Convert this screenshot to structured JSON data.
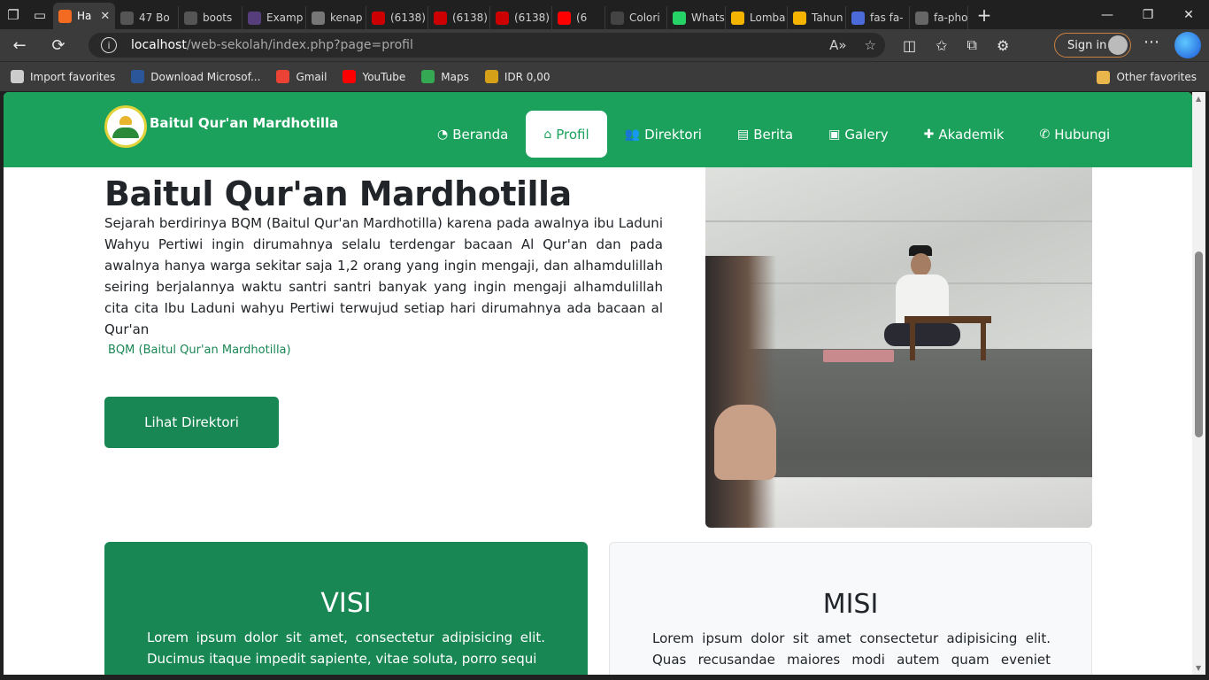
{
  "browser": {
    "tabs": [
      {
        "label": "Ha",
        "favicon": "xampp-icon",
        "color": "#f26b21",
        "active": true
      },
      {
        "label": "47 Bo",
        "favicon": "page-icon",
        "color": "#555555"
      },
      {
        "label": "boots",
        "favicon": "bootstrap-icon",
        "color": "#555555"
      },
      {
        "label": "Examp",
        "favicon": "bootstrap-b-icon",
        "color": "#563d7c"
      },
      {
        "label": "kenap",
        "favicon": "image-icon",
        "color": "#777777"
      },
      {
        "label": "(6138)",
        "favicon": "youtube-icon",
        "color": "#cc0000"
      },
      {
        "label": "(6138)",
        "favicon": "youtube-icon",
        "color": "#cc0000"
      },
      {
        "label": "(6138)",
        "favicon": "youtube-icon",
        "color": "#cc0000"
      },
      {
        "label": "(6",
        "favicon": "youtube-icon",
        "color": "#ff0000"
      },
      {
        "label": "Colori",
        "favicon": "dots-icon",
        "color": "#444444"
      },
      {
        "label": "Whats",
        "favicon": "whatsapp-icon",
        "color": "#25d366"
      },
      {
        "label": "Lomba",
        "favicon": "drive-icon",
        "color": "#f4b400"
      },
      {
        "label": "Tahun",
        "favicon": "drive-icon",
        "color": "#f4b400"
      },
      {
        "label": "fas fa-",
        "favicon": "search-icon",
        "color": "#4b6bdb"
      },
      {
        "label": "fa-pho",
        "favicon": "flag-icon",
        "color": "#666666"
      }
    ],
    "url_host": "localhost",
    "url_path": "/web-sekolah/index.php?page=profil",
    "signin_label": "Sign in",
    "favorites": [
      {
        "label": "Import favorites",
        "icon": "import-icon",
        "color": "#cccccc"
      },
      {
        "label": "Download Microsof...",
        "icon": "word-icon",
        "color": "#2b579a"
      },
      {
        "label": "Gmail",
        "icon": "gmail-icon",
        "color": "#ea4335"
      },
      {
        "label": "YouTube",
        "icon": "youtube-icon",
        "color": "#ff0000"
      },
      {
        "label": "Maps",
        "icon": "maps-icon",
        "color": "#34a853"
      },
      {
        "label": "IDR 0,00",
        "icon": "wallet-icon",
        "color": "#d4a017"
      }
    ],
    "other_favorites": "Other favorites"
  },
  "site": {
    "brand": "Baitul Qur'an Mardhotilla",
    "primary_color": "#1ba15b",
    "menu": [
      {
        "label": "Beranda",
        "icon": "dashboard-icon"
      },
      {
        "label": "Profil",
        "icon": "home-icon",
        "active": true
      },
      {
        "label": "Direktori",
        "icon": "users-icon"
      },
      {
        "label": "Berita",
        "icon": "newspaper-icon"
      },
      {
        "label": "Galery",
        "icon": "image-icon"
      },
      {
        "label": "Akademik",
        "icon": "puzzle-icon"
      },
      {
        "label": "Hubungi",
        "icon": "phone-icon"
      }
    ],
    "hero": {
      "title": "Baitul Qur'an Mardhotilla",
      "text": "Sejarah berdirinya BQM (Baitul Qur'an Mardhotilla) karena pada awalnya ibu Laduni Wahyu Pertiwi ingin dirumahnya selalu terdengar bacaan Al Qur'an dan pada awalnya hanya warga sekitar saja 1,2 orang yang ingin mengaji, dan alhamdulillah seiring berjalannya waktu santri santri banyak yang ingin mengaji alhamdulillah cita cita Ibu Laduni wahyu Pertiwi terwujud setiap hari dirumahnya ada bacaan al Qur'an",
      "caption": "BQM (Baitul Qur'an Mardhotilla)",
      "button": "Lihat Direktori"
    },
    "visi": {
      "title": "VISI",
      "text": "Lorem ipsum dolor sit amet, consectetur adipisicing elit. Ducimus itaque impedit sapiente, vitae soluta, porro sequi"
    },
    "misi": {
      "title": "MISI",
      "text": "Lorem ipsum dolor sit amet consectetur adipisicing elit. Quas recusandae maiores modi autem quam eveniet cupiditate"
    }
  }
}
